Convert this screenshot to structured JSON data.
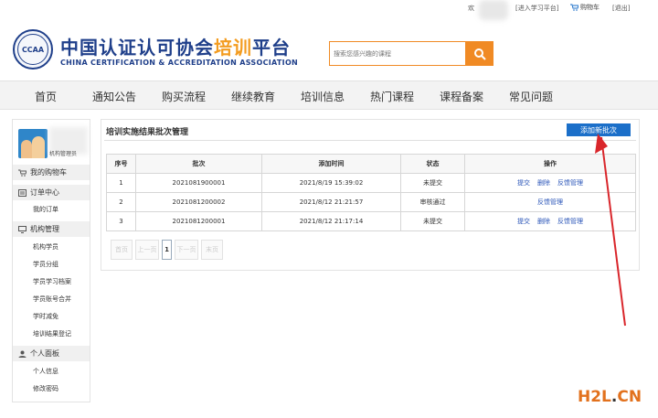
{
  "topbar": {
    "welcome": "欢",
    "enter_platform": "[进入学习平台]",
    "cart": "购物车",
    "exit": "[退出]"
  },
  "header": {
    "logo_badge": "CCAA",
    "logo_cn_main": "中国认证认可协会",
    "logo_cn_highlight": "培训",
    "logo_cn_tail": "平台",
    "logo_en": "CHINA CERTIFICATION & ACCREDITATION ASSOCIATION",
    "search_placeholder": "搜索您感兴趣的课程"
  },
  "nav": [
    "首页",
    "通知公告",
    "购买流程",
    "继续教育",
    "培训信息",
    "热门课程",
    "课程备案",
    "常见问题"
  ],
  "sidebar": {
    "user_label": "机构管理员",
    "sections": [
      {
        "title": "我的购物车",
        "icon": "cart-icon",
        "items": []
      },
      {
        "title": "订单中心",
        "icon": "order-icon",
        "items": [
          "我的订单"
        ]
      },
      {
        "title": "机构管理",
        "icon": "monitor-icon",
        "items": [
          "机构学员",
          "学员分组",
          "学员学习档案",
          "学员账号合并",
          "学时减免",
          "培训结果登记"
        ]
      },
      {
        "title": "个人面板",
        "icon": "user-icon",
        "items": [
          "个人信息",
          "修改密码"
        ]
      }
    ]
  },
  "panel": {
    "title": "培训实施结果批次管理",
    "add_button": "添加新批次",
    "columns": [
      "序号",
      "批次",
      "添加时间",
      "状态",
      "操作"
    ],
    "rows": [
      {
        "no": "1",
        "batch": "2021081900001",
        "time": "2021/8/19 15:39:02",
        "status": "未提交",
        "actions": [
          "提交",
          "删除",
          "反馈管理"
        ]
      },
      {
        "no": "2",
        "batch": "2021081200002",
        "time": "2021/8/12 21:21:57",
        "status": "审核通过",
        "actions": [
          "反馈管理"
        ]
      },
      {
        "no": "3",
        "batch": "2021081200001",
        "time": "2021/8/12 21:17:14",
        "status": "未提交",
        "actions": [
          "提交",
          "删除",
          "反馈管理"
        ]
      }
    ],
    "pager": [
      "首页",
      "上一页",
      "1",
      "下一页",
      "末页"
    ]
  },
  "watermark": {
    "a": "H2L",
    "dot": ".",
    "b": "CN"
  },
  "colors": {
    "brand_blue": "#1f3f8a",
    "accent_orange": "#f08a24",
    "button_blue": "#1b6fc9",
    "arrow_red": "#d9262b"
  }
}
